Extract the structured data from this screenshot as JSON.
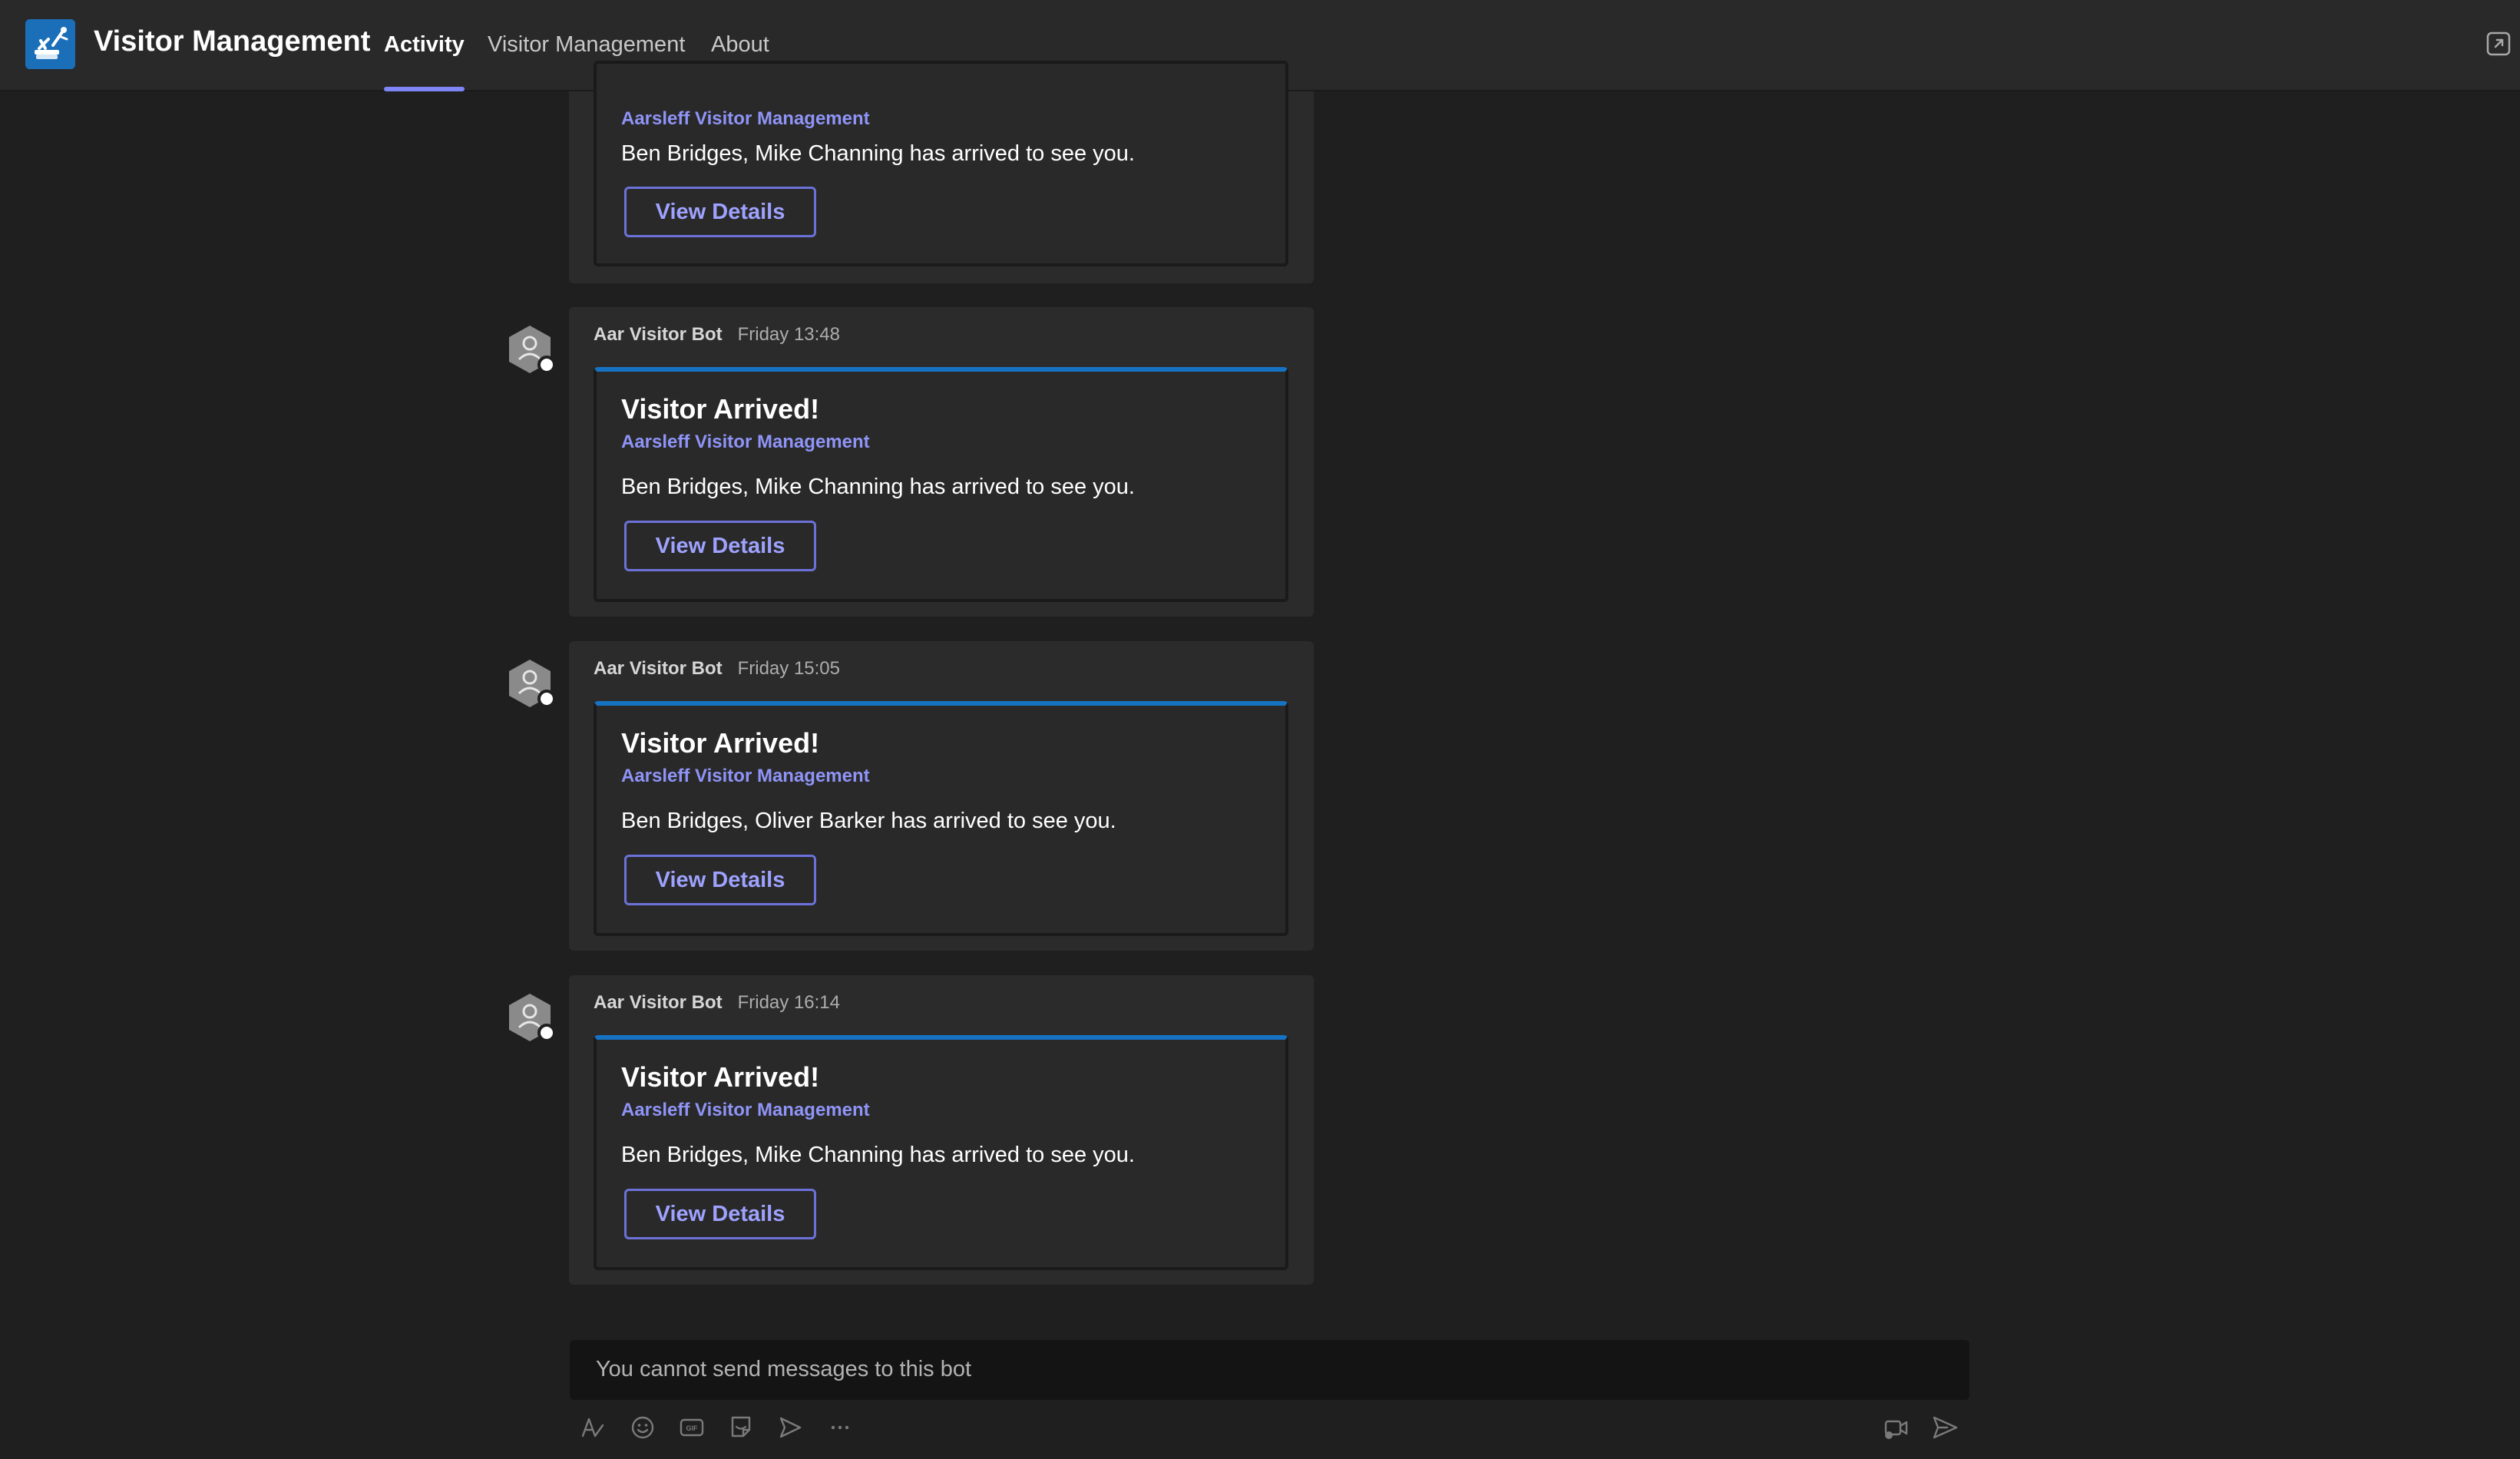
{
  "header": {
    "app_title": "Visitor Management",
    "tabs": [
      {
        "label": "Activity",
        "active": true
      },
      {
        "label": "Visitor Management",
        "active": false
      },
      {
        "label": "About",
        "active": false
      }
    ],
    "accent_color": "#7f85f5"
  },
  "messages": [
    {
      "sender": "",
      "time": "",
      "card": {
        "title": "",
        "subtitle": "Aarsleff Visitor Management",
        "body": "Ben Bridges, Mike Channing has arrived to see you.",
        "button": "View Details"
      }
    },
    {
      "sender": "Aar Visitor Bot",
      "time": "Friday 13:48",
      "card": {
        "title": "Visitor Arrived!",
        "subtitle": "Aarsleff Visitor Management",
        "body": "Ben Bridges, Mike Channing has arrived to see you.",
        "button": "View Details"
      }
    },
    {
      "sender": "Aar Visitor Bot",
      "time": "Friday 15:05",
      "card": {
        "title": "Visitor Arrived!",
        "subtitle": "Aarsleff Visitor Management",
        "body": "Ben Bridges, Oliver Barker has arrived to see you.",
        "button": "View Details"
      }
    },
    {
      "sender": "Aar Visitor Bot",
      "time": "Friday 16:14",
      "card": {
        "title": "Visitor Arrived!",
        "subtitle": "Aarsleff Visitor Management",
        "body": "Ben Bridges, Mike Channing has arrived to see you.",
        "button": "View Details"
      }
    }
  ],
  "compose": {
    "placeholder": "You cannot send messages to this bot"
  },
  "toolbar_icons": [
    "format-icon",
    "emoji-icon",
    "gif-icon",
    "sticker-icon",
    "schedule-icon",
    "more-options-icon",
    "video-clip-icon",
    "send-icon"
  ],
  "colors": {
    "background": "#1f1f1f",
    "card_accent": "#1673c4",
    "link_purple": "#8f94f7"
  }
}
